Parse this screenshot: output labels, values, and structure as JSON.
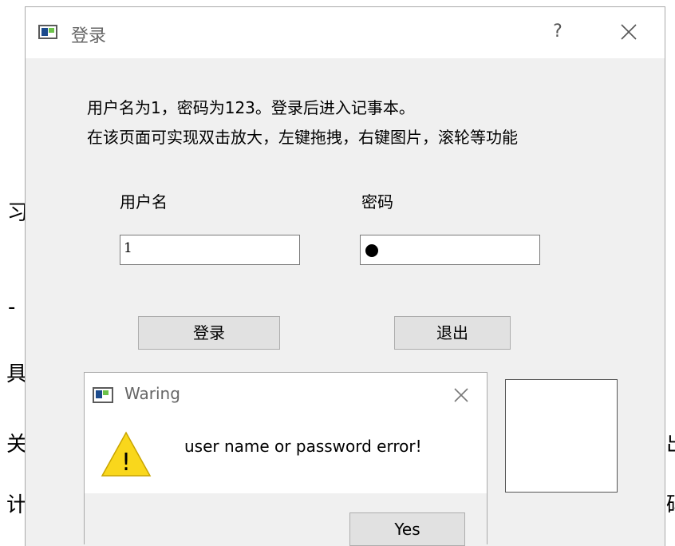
{
  "background": {
    "glyphs": [
      "习",
      "-",
      "具",
      "关",
      "计",
      "出",
      "码"
    ]
  },
  "login_window": {
    "title": "登录",
    "help_symbol": "?",
    "info_lines": [
      "用户名为1，密码为123。登录后进入记事本。",
      "在该页面可实现双击放大，左键拖拽，右键图片，滚轮等功能"
    ],
    "username_label": "用户名",
    "password_label": "密码",
    "username_value": "1",
    "password_masked": true,
    "login_button": "登录",
    "exit_button": "退出"
  },
  "warning_dialog": {
    "title": "Waring",
    "message": "user name or password error!",
    "yes_button": "Yes",
    "icon": "warning-triangle-icon",
    "icon_symbol": "!"
  },
  "colors": {
    "dialog_bg": "#f0f0f0",
    "titlebar_bg": "#ffffff",
    "button_bg": "#e1e1e1",
    "warning_yellow": "#f9d71c"
  }
}
